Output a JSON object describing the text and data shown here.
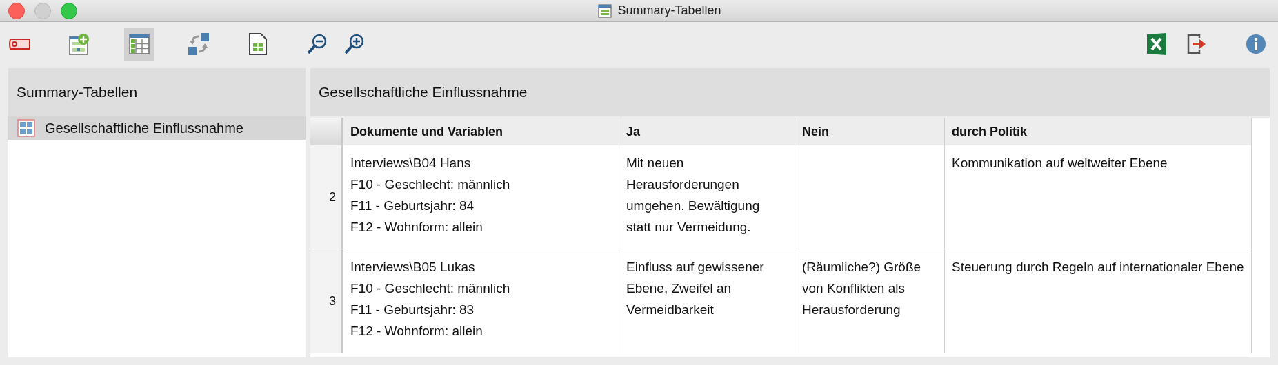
{
  "window": {
    "title": "Summary-Tabellen"
  },
  "toolbar": {
    "left": [
      {
        "kind": "tag",
        "selected": false
      },
      {
        "kind": "add-table",
        "selected": false
      },
      {
        "kind": "table",
        "selected": true
      },
      {
        "kind": "swap",
        "selected": false
      },
      {
        "kind": "sheet",
        "selected": false
      },
      {
        "kind": "zoom-out",
        "selected": false
      },
      {
        "kind": "zoom-in",
        "selected": false
      }
    ],
    "right": [
      {
        "kind": "excel",
        "selected": false
      },
      {
        "kind": "export",
        "selected": false
      },
      {
        "kind": "info",
        "selected": false
      }
    ]
  },
  "sidebar": {
    "title": "Summary-Tabellen",
    "items": [
      {
        "label": "Gesellschaftliche Einflussnahme",
        "selected": true
      }
    ]
  },
  "main": {
    "title": "Gesellschaftliche Einflussnahme",
    "table": {
      "columns": [
        "Dokumente und Variablen",
        "Ja",
        "Nein",
        "durch Politik"
      ],
      "rows": [
        {
          "number": "2",
          "documents": [
            "Interviews\\B04 Hans",
            "F10 - Geschlecht: männlich",
            "F11 - Geburtsjahr: 84",
            "F12 - Wohnform: allein"
          ],
          "ja": "Mit neuen Herausforderungen umgehen. Bewältigung statt nur Vermeidung.",
          "politik": "Kommunikation auf weltweiter Ebene"
        },
        {
          "number": "3",
          "documents": [
            "Interviews\\B05 Lukas",
            "F10 - Geschlecht: männlich",
            "F11 - Geburtsjahr: 83",
            "F12 - Wohnform: allein"
          ],
          "ja": "Einfluss auf gewissener Ebene, Zweifel an Vermeidbarkeit",
          "nein": "(Räumliche?) Größe von Konflikten als Herausforderung",
          "politik": "Steuerung durch Regeln auf internationaler Ebene"
        }
      ]
    }
  }
}
